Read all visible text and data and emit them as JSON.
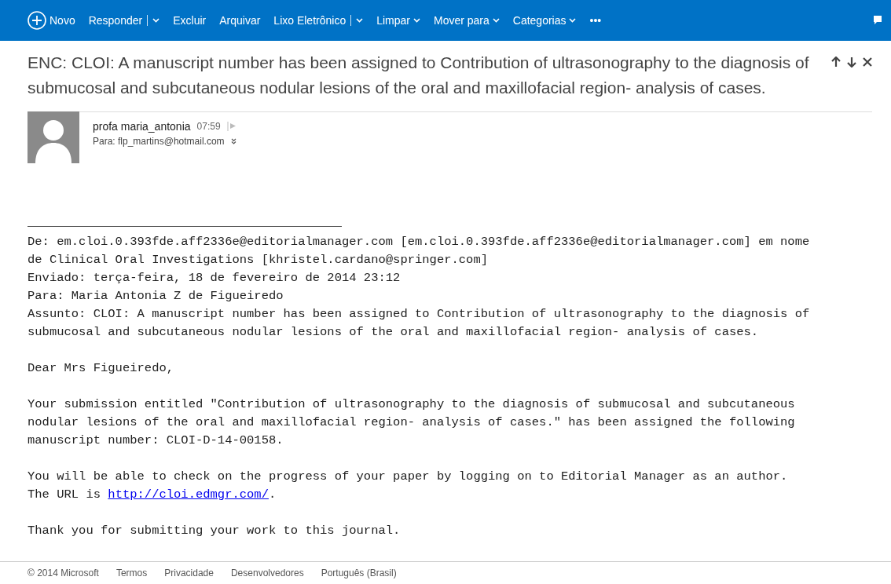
{
  "toolbar": {
    "items": [
      {
        "label": "Novo",
        "kind": "new"
      },
      {
        "label": "Responder",
        "kind": "split"
      },
      {
        "label": "Excluir",
        "kind": "plain"
      },
      {
        "label": "Arquivar",
        "kind": "plain"
      },
      {
        "label": "Lixo Eletrônico",
        "kind": "split"
      },
      {
        "label": "Limpar",
        "kind": "menu"
      },
      {
        "label": "Mover para",
        "kind": "menu"
      },
      {
        "label": "Categorias",
        "kind": "menu"
      },
      {
        "label": "•••",
        "kind": "plain"
      }
    ]
  },
  "message": {
    "subject": "ENC: CLOI: A manuscript number has been assigned to Contribution of ultrasonography to the diagnosis of submucosal and subcutaneous nodular lesions of the oral and maxillofacial region- analysis of cases.",
    "sender": "profa maria_antonia",
    "time": "07:59",
    "to": "Para: flp_martins@hotmail.com",
    "body": [
      {
        "kind": "text",
        "lines": [
          "De: em.cloi.0.393fde.aff2336e@editorialmanager.com [em.cloi.0.393fde.aff2336e@editorialmanager.com] em nome",
          "de Clinical Oral Investigations [khristel.cardano@springer.com]",
          "Enviado: terça-feira, 18 de fevereiro de 2014 23:12",
          "Para: Maria Antonia Z de Figueiredo",
          "Assunto: CLOI: A manuscript number has been assigned to Contribution of ultrasonography to the diagnosis of",
          "submucosal and subcutaneous nodular lesions of the oral and maxillofacial region- analysis of cases."
        ]
      },
      {
        "kind": "text",
        "lines": [
          "Dear Mrs Figueiredo,"
        ]
      },
      {
        "kind": "text",
        "lines": [
          "Your submission entitled \"Contribution of ultrasonography to the diagnosis of submucosal and subcutaneous",
          "nodular lesions of the oral and maxillofacial region- analysis of cases.\" has been assigned the following",
          "manuscript number: CLOI-D-14-00158."
        ]
      },
      {
        "kind": "link",
        "lines": [
          "You will be able to check on the progress of your paper by logging on to Editorial Manager as an author."
        ],
        "before": "The URL is ",
        "link": "http://cloi.edmgr.com/",
        "after": "."
      },
      {
        "kind": "text",
        "lines": [
          "Thank you for submitting your work to this journal."
        ]
      }
    ]
  },
  "footer": [
    "© 2014 Microsoft",
    "Termos",
    "Privacidade",
    "Desenvolvedores",
    "Português (Brasil)"
  ]
}
